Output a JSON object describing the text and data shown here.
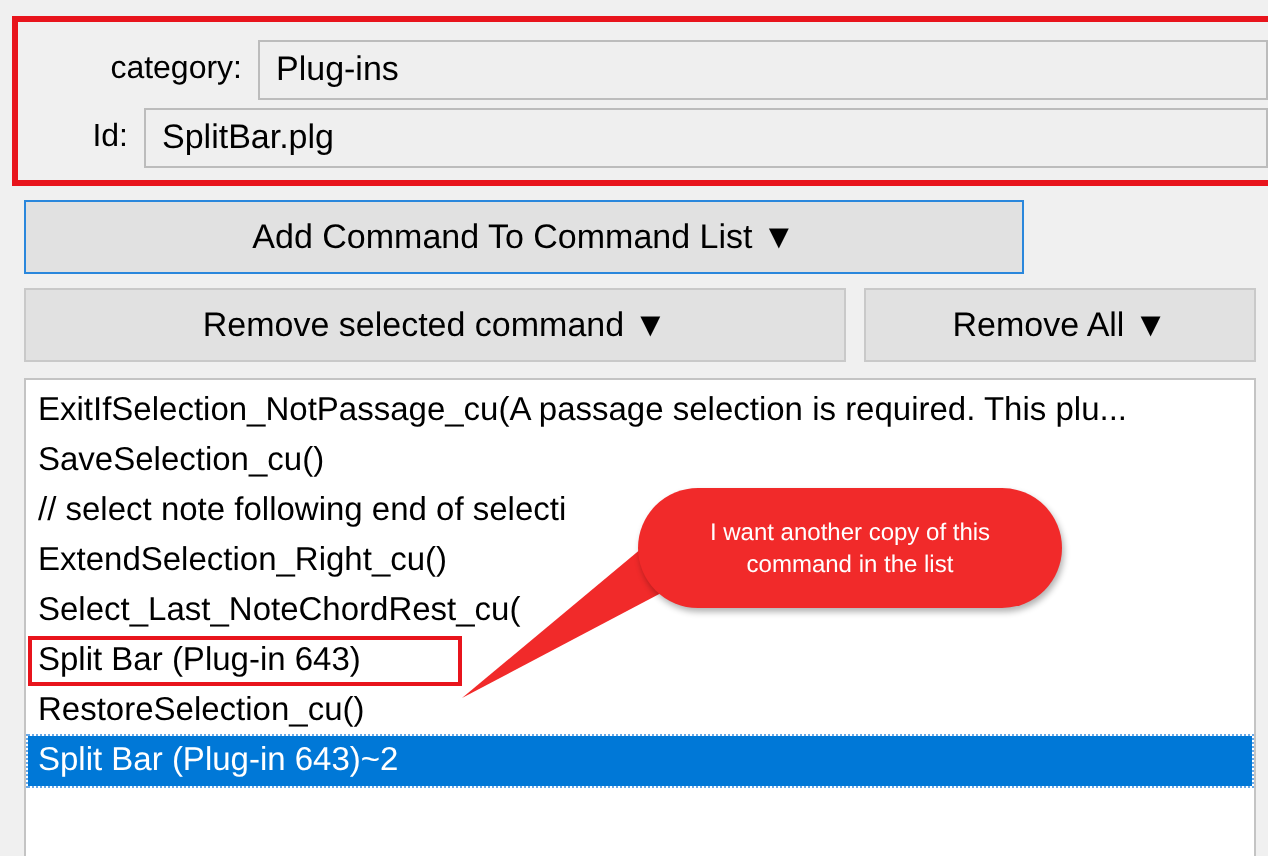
{
  "fields_panel": {
    "highlighted": true,
    "fields": [
      {
        "label": "category:",
        "value": "Plug-ins"
      },
      {
        "label": "Id:",
        "value": "SplitBar.plg"
      }
    ]
  },
  "buttons": [
    {
      "label": "Add Command To Command List ▼",
      "focused": true,
      "kind": "wide"
    },
    {
      "label": "Remove selected command ▼",
      "focused": false,
      "kind": "split"
    },
    {
      "label": "Remove All ▼",
      "focused": false,
      "kind": "split"
    }
  ],
  "command_list": {
    "items": [
      {
        "text": "ExitIfSelection_NotPassage_cu(A passage selection is required. This plu...",
        "selected": false,
        "highlighted": false
      },
      {
        "text": "SaveSelection_cu()",
        "selected": false,
        "highlighted": false
      },
      {
        "text": "// select note following end of selecti",
        "selected": false,
        "highlighted": false
      },
      {
        "text": "ExtendSelection_Right_cu()",
        "selected": false,
        "highlighted": false
      },
      {
        "text": "Select_Last_NoteChordRest_cu(",
        "selected": false,
        "highlighted": false
      },
      {
        "text": "Split Bar (Plug-in 643)",
        "selected": false,
        "highlighted": true
      },
      {
        "text": "RestoreSelection_cu()",
        "selected": false,
        "highlighted": false
      },
      {
        "text": "Split Bar (Plug-in 643)~2",
        "selected": true,
        "highlighted": false
      }
    ]
  },
  "callout": {
    "text": "I want another copy of this command in the list"
  }
}
